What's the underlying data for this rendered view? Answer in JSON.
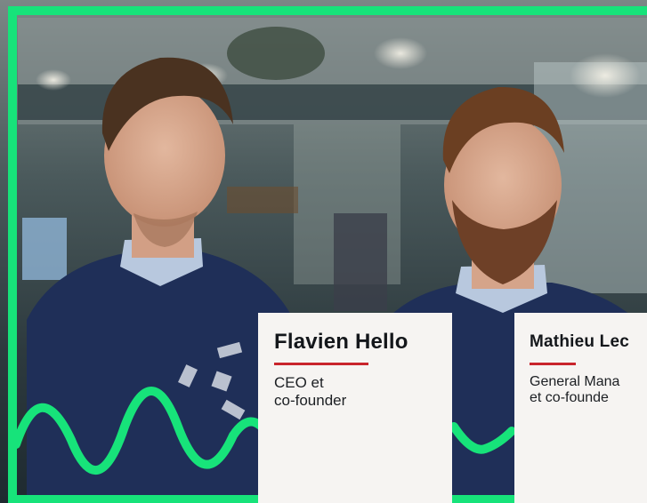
{
  "people": [
    {
      "name": "Flavien Hello",
      "role": "CEO et\nco-founder"
    },
    {
      "name": "Mathieu Lec",
      "role": "General Mana\net co-founde"
    }
  ],
  "colors": {
    "accent_green": "#17e37a",
    "rule_red": "#c9252c",
    "card_bg": "#f6f4f2",
    "sweater_navy": "#1f2f58"
  }
}
